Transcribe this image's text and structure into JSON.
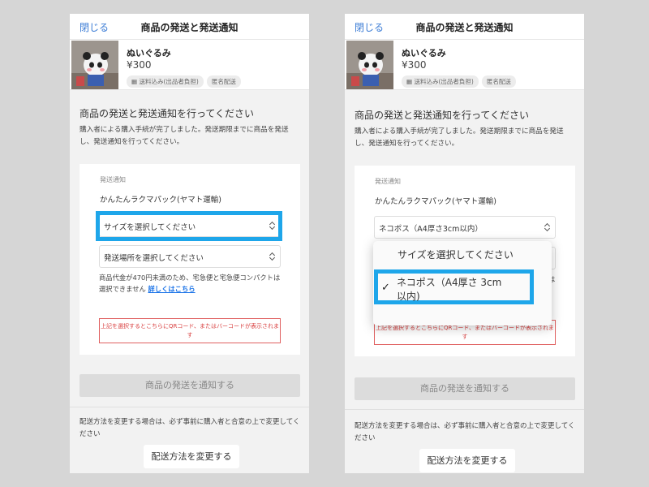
{
  "header": {
    "close_label": "閉じる",
    "title": "商品の発送と発送通知"
  },
  "product": {
    "name": "ぬいぐるみ",
    "price": "¥300",
    "tag_shipping": "送料込み(出品者負担)",
    "tag_anonymous": "匿名配送"
  },
  "section": {
    "title": "商品の発送と発送通知を行ってください",
    "description": "購入者による購入手続が完了しました。発送期限までに商品を発送し、発送通知を行ってください。"
  },
  "card": {
    "label": "発送通知",
    "method": "かんたんラクマパック(ヤマト運輸)",
    "size_placeholder": "サイズを選択してください",
    "size_selected": "ネコポス（A4厚さ3cm以内）",
    "location_placeholder": "発送場所を選択してください",
    "note": "商品代金が470円未満のため、宅急便と宅急便コンパクトは選択できません",
    "note_link": "詳しくはこちら",
    "warning": "上記を選択するとこちらにQRコード、またはバーコードが表示されます"
  },
  "notify_button": "商品の発送を通知する",
  "change": {
    "note": "配送方法を変更する場合は、必ず事前に購入者と合意の上で変更してください",
    "button": "配送方法を変更する"
  },
  "dropdown": {
    "option1": "サイズを選択してください",
    "option2_line1": "ネコポス（A4厚さ 3cm",
    "option2_line2": "以内)",
    "check": "✓"
  },
  "colors": {
    "highlight": "#1ea6ea",
    "link": "#1a73e8",
    "warning": "#d94040",
    "close": "#3a7bd5"
  },
  "icons": {
    "tag_icon": "truck-icon",
    "select_caret": "up-down-caret-icon"
  }
}
